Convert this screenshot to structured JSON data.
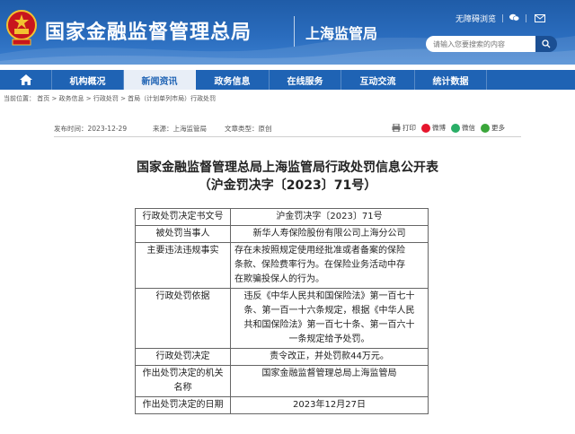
{
  "header": {
    "title": "国家金融监督管理总局",
    "subtitle": "上海监管局",
    "links": {
      "accessible": "无障碍浏览",
      "sep": "|"
    },
    "search_placeholder": "请输入您要搜索的内容",
    "colors": {
      "primary": "#1f63b4",
      "dark": "#1b4f93"
    }
  },
  "nav": {
    "items": [
      "机构概况",
      "新闻资讯",
      "政务信息",
      "在线服务",
      "互动交流",
      "统计数据"
    ],
    "active_index": 1
  },
  "breadcrumb": "当前位置： 首页 > 政务信息 > 行政处罚 > 首局（计划单列市局）行政处罚",
  "meta": {
    "published": "发布时间：2023-12-29",
    "source": "来源：上海监管局",
    "doctype": "文章类型：原创"
  },
  "share": {
    "print": "打印",
    "weibo": "微博",
    "wechat": "微信",
    "more": "更多"
  },
  "document": {
    "title": "国家金融监督管理总局上海监管局行政处罚信息公开表",
    "number": "（沪金罚决字〔2023〕71号）",
    "rows": [
      {
        "label": "行政处罚决定书文号",
        "value": [
          "沪金罚决字〔2023〕71号"
        ],
        "align": "center"
      },
      {
        "label": "被处罚当事人",
        "value": [
          "新华人寿保险股份有限公司上海分公司"
        ],
        "align": "center"
      },
      {
        "label": "主要违法违规事实",
        "value": [
          "存在未按照规定使用经批准或者备案的保险",
          "条款、保险费率行为。在保险业务活动中存",
          "在欺骗投保人的行为。"
        ],
        "align": "left"
      },
      {
        "label": "行政处罚依据",
        "value": [
          "违反《中华人民共和国保险法》第一百七十",
          "条、第一百一十六条规定，根据《中华人民",
          "共和国保险法》第一百七十条、第一百六十",
          "一条规定给予处罚。"
        ],
        "align": "center"
      },
      {
        "label": "行政处罚决定",
        "value": [
          "责令改正，并处罚款44万元。"
        ],
        "align": "center"
      },
      {
        "label": [
          "作出处罚决定的机关",
          "名称"
        ],
        "value": [
          "国家金融监督管理总局上海监管局"
        ],
        "align": "center"
      },
      {
        "label": "作出处罚决定的日期",
        "value": [
          "2023年12月27日"
        ],
        "align": "center"
      }
    ]
  }
}
